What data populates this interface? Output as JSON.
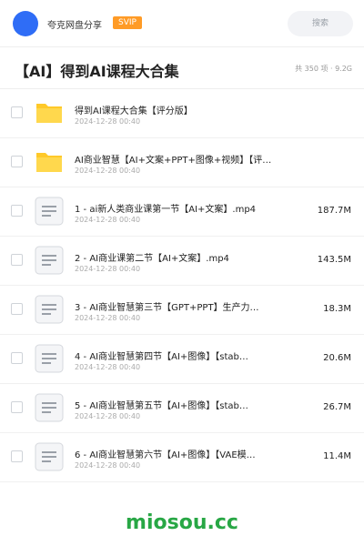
{
  "header": {
    "username": "夸克网盘分享",
    "badge": "SVIP",
    "search_label": "搜索"
  },
  "title": {
    "text": "【AI】得到AI课程大合集",
    "summary": "共 350 项 · 9.2G"
  },
  "files": [
    {
      "icon": "folder-icon",
      "name": "得到AI课程大合集【评分版】",
      "date": "2024-12-28 00:40",
      "size": ""
    },
    {
      "icon": "folder-icon",
      "name": "AI商业智慧【AI+文案+PPT+图像+视频】【评…",
      "date": "2024-12-28 00:40",
      "size": ""
    },
    {
      "icon": "document-icon",
      "name": "1 - ai新人类商业课第一节【AI+文案】.mp4",
      "date": "2024-12-28 00:40",
      "size": "187.7M"
    },
    {
      "icon": "document-icon",
      "name": "2 - AI商业课第二节【AI+文案】.mp4",
      "date": "2024-12-28 00:40",
      "size": "143.5M"
    },
    {
      "icon": "document-icon",
      "name": "3 - AI商业智慧第三节【GPT+PPT】生产力…",
      "date": "2024-12-28 00:40",
      "size": "18.3M"
    },
    {
      "icon": "document-icon",
      "name": "4 - AI商业智慧第四节【AI+图像】【stab…",
      "date": "2024-12-28 00:40",
      "size": "20.6M"
    },
    {
      "icon": "document-icon",
      "name": "5 - AI商业智慧第五节【AI+图像】【stab…",
      "date": "2024-12-28 00:40",
      "size": "26.7M"
    },
    {
      "icon": "document-icon",
      "name": "6 - AI商业智慧第六节【AI+图像】【VAE模…",
      "date": "2024-12-28 00:40",
      "size": "11.4M"
    }
  ],
  "watermark": "miosou.cc",
  "colors": {
    "avatar": "#2f6df6",
    "badge": "#ff9b26",
    "folder": "#ffc929",
    "watermark": "#28a745"
  }
}
